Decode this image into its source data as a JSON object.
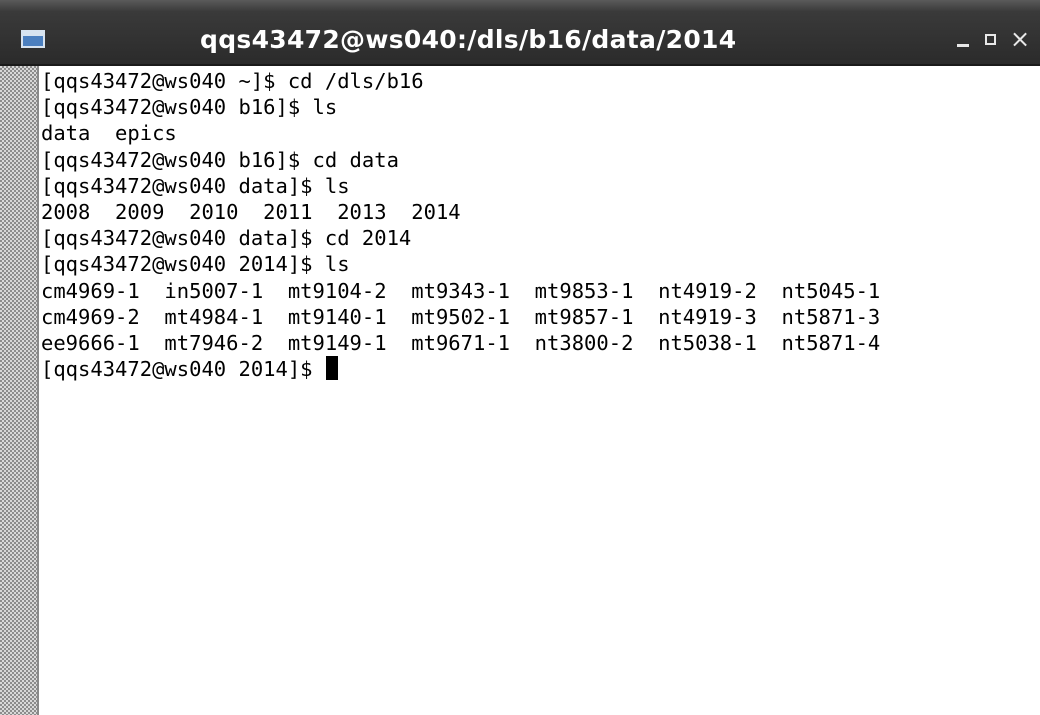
{
  "window": {
    "title": "qqs43472@ws040:/dls/b16/data/2014",
    "icon": "terminal-app-icon",
    "buttons": {
      "minimize_icon": "minimize-icon",
      "maximize_icon": "maximize-icon",
      "close_icon": "close-icon",
      "minimize_glyph": "_",
      "maximize_glyph": "□",
      "close_glyph": "×"
    },
    "colors": {
      "titlebar": "#2b2b2b",
      "title_text": "#ffffff",
      "terminal_bg": "#ffffff",
      "terminal_fg": "#000000"
    }
  },
  "terminal": {
    "lines": [
      "[qqs43472@ws040 ~]$ cd /dls/b16",
      "[qqs43472@ws040 b16]$ ls",
      "data  epics",
      "[qqs43472@ws040 b16]$ cd data",
      "[qqs43472@ws040 data]$ ls",
      "2008  2009  2010  2011  2013  2014",
      "[qqs43472@ws040 data]$ cd 2014",
      "[qqs43472@ws040 2014]$ ls",
      "cm4969-1  in5007-1  mt9104-2  mt9343-1  mt9853-1  nt4919-2  nt5045-1",
      "cm4969-2  mt4984-1  mt9140-1  mt9502-1  mt9857-1  nt4919-3  nt5871-3",
      "ee9666-1  mt7946-2  mt9149-1  mt9671-1  nt3800-2  nt5038-1  nt5871-4"
    ],
    "prompt": "[qqs43472@ws040 2014]$ "
  }
}
